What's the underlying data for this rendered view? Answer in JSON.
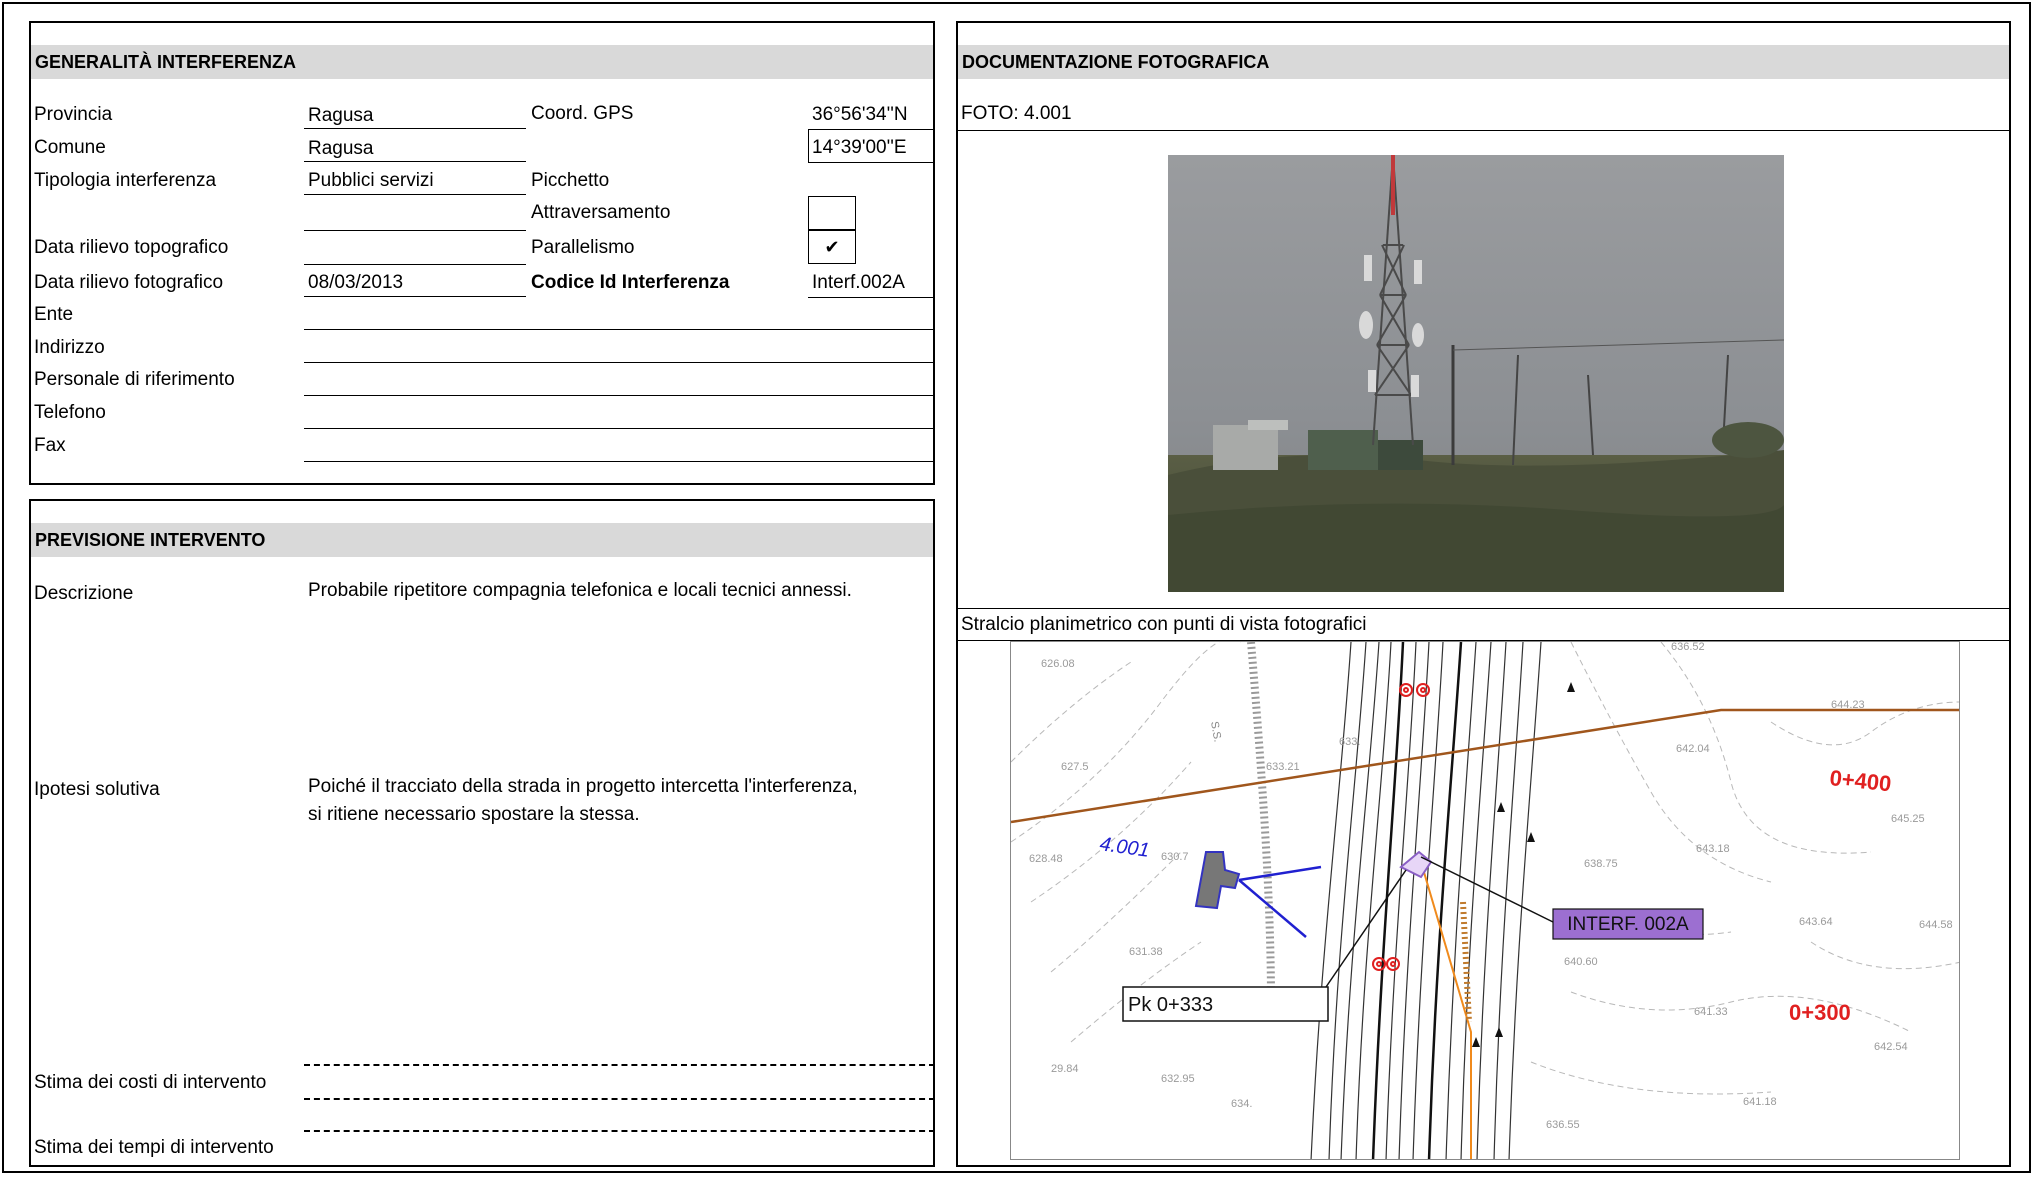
{
  "generalita": {
    "title": "GENERALITÀ  INTERFERENZA",
    "labels": {
      "provincia": "Provincia",
      "comune": "Comune",
      "tipologia": "Tipologia interferenza",
      "data_topo": "Data rilievo topografico",
      "data_foto": "Data rilievo fotografico",
      "ente": "Ente",
      "indirizzo": "Indirizzo",
      "personale": "Personale di riferimento",
      "telefono": "Telefono",
      "fax": "Fax",
      "coord": "Coord. GPS",
      "picchetto": "Picchetto",
      "attraversamento": "Attraversamento",
      "parallelismo": "Parallelismo",
      "codice": "Codice Id Interferenza"
    },
    "values": {
      "provincia": "Ragusa",
      "comune": "Ragusa",
      "tipologia": "Pubblici servizi",
      "data_foto": "08/03/2013",
      "gps_lat": "36°56'34''N",
      "gps_lon": "14°39'00''E",
      "parallelismo_check": "✔",
      "codice": "Interf.002A"
    }
  },
  "previsione": {
    "title": "PREVISIONE INTERVENTO",
    "descrizione_label": "Descrizione",
    "descrizione_text": "Probabile ripetitore compagnia telefonica e locali tecnici annessi.",
    "ipotesi_label": "Ipotesi solutiva",
    "ipotesi_line1": "Poiché il tracciato della strada in progetto intercetta l'interferenza,",
    "ipotesi_line2": "si ritiene necessario spostare la stessa.",
    "costi_label": "Stima dei costi di intervento",
    "tempi_label": "Stima dei tempi di intervento"
  },
  "documentazione": {
    "title": "DOCUMENTAZIONE FOTOGRAFICA",
    "foto_label": "FOTO: 4.001",
    "stralcio_label": "Stralcio planimetrico con punti di vista fotografici"
  },
  "map": {
    "view_point": "4.001",
    "interf_label": "INTERF. 002A",
    "pk_label": "Pk 0+333",
    "km_400": "0+400",
    "km_300": "0+300",
    "road_label": "S.S.",
    "elevations": [
      "626.08",
      "627.5",
      "633.",
      "628.48",
      "630.7",
      "631.38",
      "642.04",
      "643.18",
      "638.75",
      "645.25",
      "643.64",
      "640.60",
      "641.33",
      "642.54",
      "644.58",
      "641.18",
      "636.55",
      "632.95",
      "29.84",
      "634.",
      "633.21",
      "636.52",
      "644.23"
    ]
  },
  "colors": {
    "header_bg": "#d9d9d9",
    "map_purple": "#9c6fd1",
    "map_red": "#e02020",
    "map_brown": "#a0561c",
    "map_blue": "#2020d0",
    "map_orange": "#f08a1c"
  }
}
